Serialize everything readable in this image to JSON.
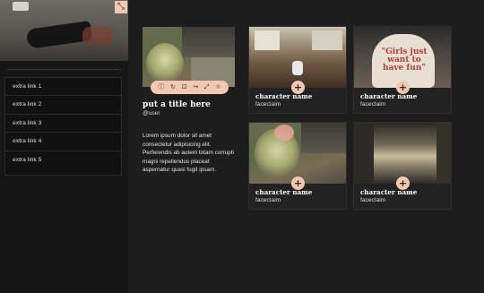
{
  "sidebar": {
    "corner_icon": "collapse-arrows-icon",
    "links": [
      "extra link 1",
      "extra link 2",
      "extra link 3",
      "extra link 4",
      "extra link 5"
    ]
  },
  "profile": {
    "icons": [
      "info-icon",
      "refresh-icon",
      "inbox-icon",
      "share-icon",
      "expand-icon",
      "sun-icon"
    ],
    "title": "put a title here",
    "user": "@user",
    "bio": "Lorem ipsum dolor sit amet consectetur adipisicing elit. Perferendis ab autem totam corrupti magni repellendus placeat aspernatur quasi fugit ipsam."
  },
  "cards": [
    {
      "name": "character name",
      "sub": "faceclaim"
    },
    {
      "name": "character name",
      "sub": "faceclaim",
      "image_text": "\"Girls just want to have fun\""
    },
    {
      "name": "character name",
      "sub": "faceclaim"
    },
    {
      "name": "character name",
      "sub": "faceclaim"
    }
  ],
  "colors": {
    "accent": "#f2c9b0",
    "background": "#1d1d1d",
    "sidebar": "#161616"
  }
}
